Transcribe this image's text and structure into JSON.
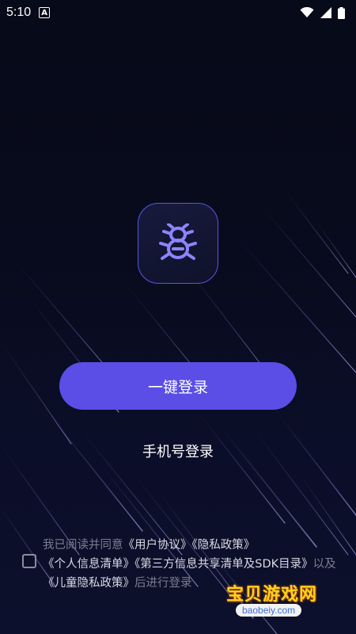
{
  "status_bar": {
    "time": "5:10",
    "notification_glyph": "A",
    "icons": [
      "wifi-icon",
      "cellular-signal-icon",
      "battery-icon"
    ]
  },
  "logo": {
    "icon": "bug-robot-icon",
    "accent_color": "#5d54e8"
  },
  "one_click_login": {
    "label": "一键登录",
    "color": "#5a4ee6"
  },
  "phone_login": {
    "label": "手机号登录"
  },
  "agreement": {
    "checked": false,
    "prefix": "我已阅读并同意",
    "user_agreement": "《用户协议》",
    "privacy_policy": "《隐私政策》",
    "personal_info_list": "《个人信息清单》",
    "third_party_list": "《第三方信息共享清单及SDK目录》",
    "and": "以及",
    "child_privacy": "《儿童隐私政策》",
    "suffix": "后进行登录"
  },
  "watermark": {
    "title": "宝贝游戏网",
    "url": "baobeiy.com"
  }
}
